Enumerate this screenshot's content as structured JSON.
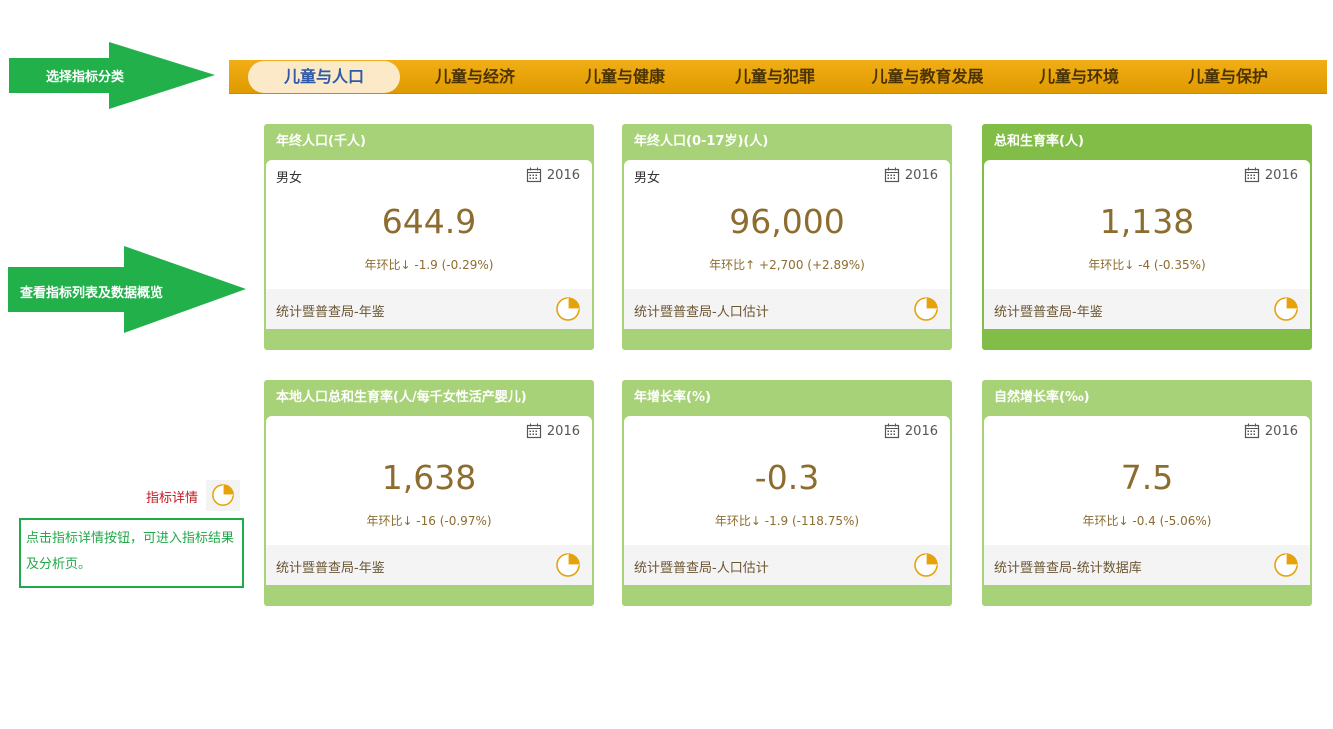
{
  "annotations": {
    "select_category": "选择指标分类",
    "view_indicators": "查看指标列表及数据概览",
    "legend_label": "指标详情",
    "legend_note": "点击指标详情按钮，可进入指标结果及分析页。"
  },
  "tabs": [
    {
      "label": "儿童与人口",
      "active": true
    },
    {
      "label": "儿童与经济",
      "active": false
    },
    {
      "label": "儿童与健康",
      "active": false
    },
    {
      "label": "儿童与犯罪",
      "active": false
    },
    {
      "label": "儿童与教育发展",
      "active": false
    },
    {
      "label": "儿童与环境",
      "active": false
    },
    {
      "label": "儿童与保护",
      "active": false
    }
  ],
  "cards": [
    {
      "title": "年终人口(千人)",
      "subtitle": "男女",
      "year": "2016",
      "value": "644.9",
      "yoy": "年环比↓ -1.9 (-0.29%)",
      "source": "统计暨普查局-年鉴"
    },
    {
      "title": "年终人口(0-17岁)(人)",
      "subtitle": "男女",
      "year": "2016",
      "value": "96,000",
      "yoy": "年环比↑ +2,700 (+2.89%)",
      "source": "统计暨普查局-人口估计"
    },
    {
      "title": "总和生育率(人)",
      "subtitle": "",
      "year": "2016",
      "value": "1,138",
      "yoy": "年环比↓ -4 (-0.35%)",
      "source": "统计暨普查局-年鉴"
    },
    {
      "title": "本地人口总和生育率(人/每千女性活产婴儿)",
      "subtitle": "",
      "year": "2016",
      "value": "1,638",
      "yoy": "年环比↓ -16 (-0.97%)",
      "source": "统计暨普查局-年鉴"
    },
    {
      "title": "年增长率(%)",
      "subtitle": "",
      "year": "2016",
      "value": "-0.3",
      "yoy": "年环比↓ -1.9 (-118.75%)",
      "source": "统计暨普查局-人口估计"
    },
    {
      "title": "自然增长率(‰)",
      "subtitle": "",
      "year": "2016",
      "value": "7.5",
      "yoy": "年环比↓ -0.4 (-5.06%)",
      "source": "统计暨普查局-统计数据库"
    }
  ],
  "icons": {
    "calendar": "calendar-icon",
    "detail": "pie-chart-icon"
  },
  "colors": {
    "nav_bar": "#eca30a",
    "active_tab_bg": "#fbe9c8",
    "active_tab_text": "#2f5aa8",
    "card_header": "#a8d278",
    "card_header_highlight": "#82be47",
    "value_text": "#8c6d2f",
    "annotation_arrow": "#22b04b",
    "detail_icon": "#e6a20a"
  }
}
